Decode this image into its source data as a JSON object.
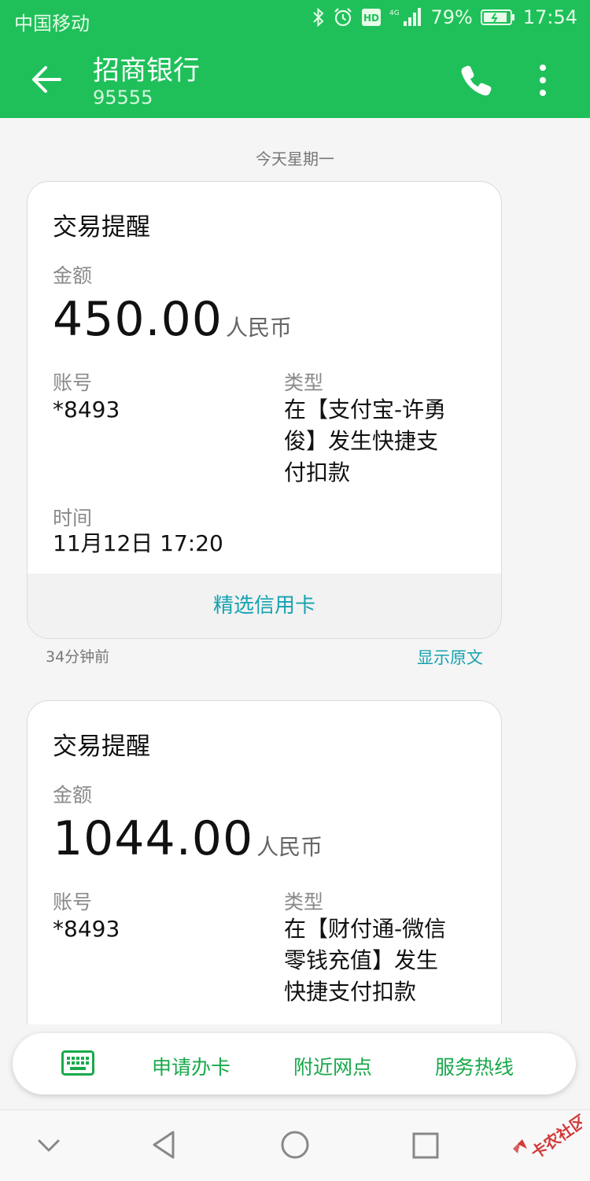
{
  "status_bar": {
    "carrier": "中国移动",
    "battery": "79%",
    "time": "17:54",
    "icons": [
      "bluetooth-icon",
      "alarm-icon",
      "hd-icon",
      "4g-signal-icon",
      "battery-icon"
    ]
  },
  "header": {
    "title": "招商银行",
    "subtitle": "95555",
    "icons": [
      "back-arrow-icon",
      "phone-icon",
      "more-vertical-icon"
    ]
  },
  "conversation": {
    "day_label": "今天星期一",
    "messages": [
      {
        "card_title": "交易提醒",
        "amount_label": "金额",
        "amount": "450.00",
        "currency": "人民币",
        "account_label": "账号",
        "account": "*8493",
        "type_label": "类型",
        "type_lines": [
          "在【支付宝-许勇",
          "俊】发生快捷支",
          "付扣款"
        ],
        "time_label": "时间",
        "time": "11月12日 17:20",
        "footer_link": "精选信用卡",
        "relative_time": "34分钟前",
        "show_original": "显示原文"
      },
      {
        "card_title": "交易提醒",
        "amount_label": "金额",
        "amount": "1044.00",
        "currency": "人民币",
        "account_label": "账号",
        "account": "*8493",
        "type_label": "类型",
        "type_lines": [
          "在【财付通-微信",
          "零钱充值】发生",
          "快捷支付扣款"
        ]
      }
    ]
  },
  "bottom_menu": {
    "items": [
      "申请办卡",
      "附近网点",
      "服务热线"
    ],
    "keyboard_icon": "keyboard-icon"
  },
  "colors": {
    "brand_green": "#1fc05a",
    "link_teal": "#16a2b0",
    "menu_green": "#19a94b"
  }
}
